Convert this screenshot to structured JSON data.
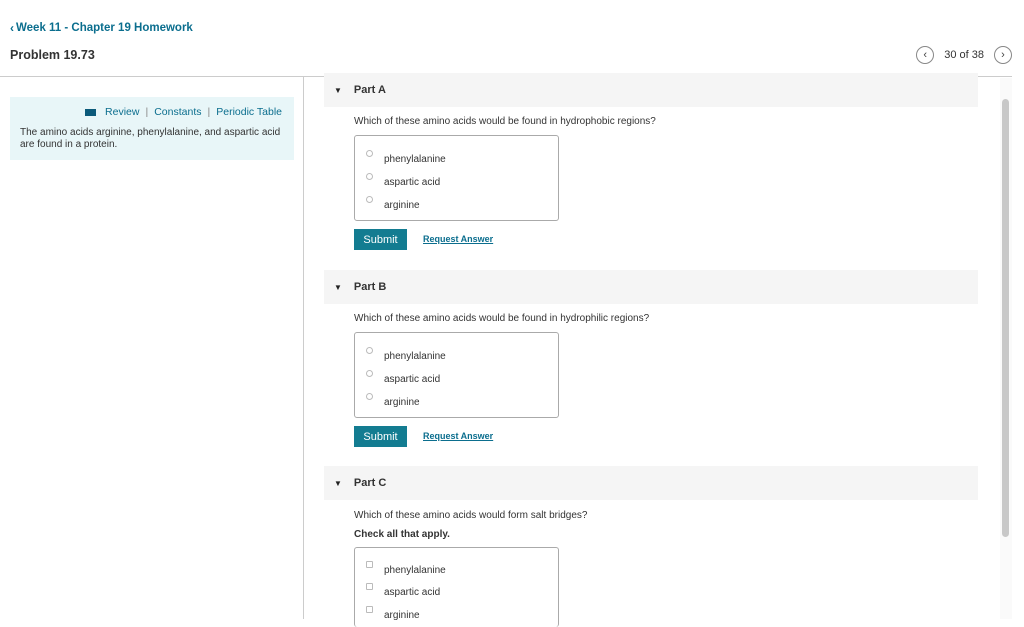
{
  "header": {
    "back_label": "Week 11 - Chapter 19 Homework",
    "problem_title": "Problem 19.73",
    "pager_text": "30 of 38"
  },
  "info": {
    "links": [
      "Review",
      "Constants",
      "Periodic Table"
    ],
    "text": "The amino acids arginine, phenylalanine, and aspartic acid are found in a protein."
  },
  "parts": [
    {
      "label": "Part A",
      "question": "Which of these amino acids would be found in hydrophobic regions?",
      "instruction": "",
      "options": [
        "phenylalanine",
        "aspartic acid",
        "arginine"
      ],
      "submit_label": "Submit",
      "request_label": "Request Answer"
    },
    {
      "label": "Part B",
      "question": "Which of these amino acids would be found in hydrophilic regions?",
      "instruction": "",
      "options": [
        "phenylalanine",
        "aspartic acid",
        "arginine"
      ],
      "submit_label": "Submit",
      "request_label": "Request Answer"
    },
    {
      "label": "Part C",
      "question": "Which of these amino acids would form salt bridges?",
      "instruction": "Check all that apply.",
      "options": [
        "phenylalanine",
        "aspartic acid",
        "arginine"
      ]
    }
  ],
  "colors": {
    "accent": "#137c91",
    "link": "#0b6e8e",
    "info_bg": "#e8f6f8"
  }
}
